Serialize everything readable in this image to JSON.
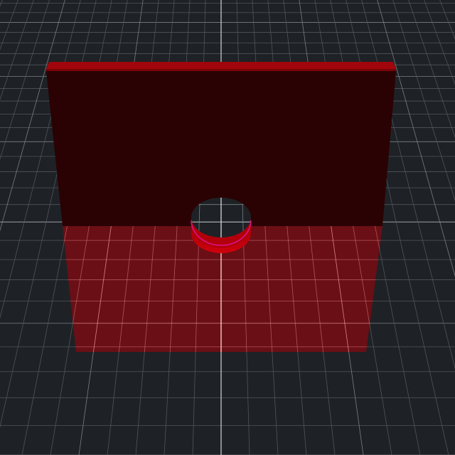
{
  "scene": {
    "object": "plate-with-hole",
    "colors": {
      "background": "#1e2226",
      "grid_line": "#6b7077",
      "grid_axis": "#b8bcc2",
      "plate_face_dark": "#2a0203",
      "plate_top_edge": "#a0060c",
      "plate_translucent": "#c4000a",
      "hole_edge": "#e0108a"
    }
  }
}
